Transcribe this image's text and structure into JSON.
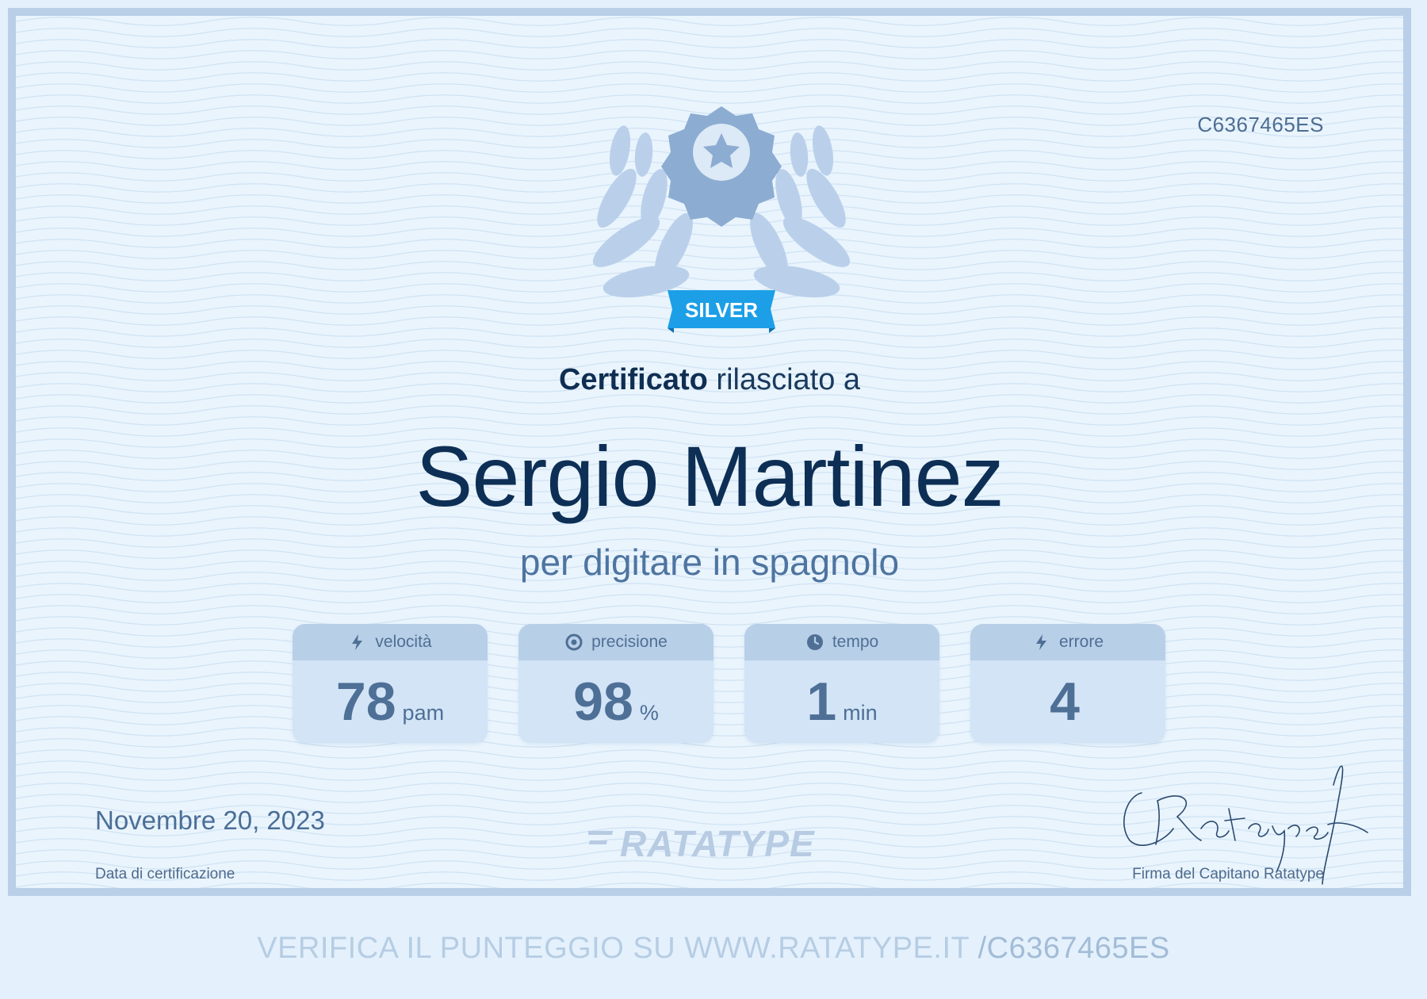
{
  "certificate": {
    "code": "C6367465ES",
    "badge": "SILVER",
    "title_bold": "Certificato",
    "title_rest": "rilasciato a",
    "recipient": "Sergio Martinez",
    "subtitle": "per digitare in spagnolo",
    "stats": [
      {
        "label": "velocità",
        "icon": "lightning-icon",
        "value": "78",
        "unit": "pam"
      },
      {
        "label": "precisione",
        "icon": "target-icon",
        "value": "98",
        "unit": "%"
      },
      {
        "label": "tempo",
        "icon": "clock-icon",
        "value": "1",
        "unit": "min"
      },
      {
        "label": "errore",
        "icon": "lightning-icon",
        "value": "4",
        "unit": ""
      }
    ],
    "date": "Novembre 20, 2023",
    "date_label": "Data di certificazione",
    "logo": "RATATYPE",
    "signature_label": "Firma del Capitano Ratatype"
  },
  "footer": {
    "verify_text": "VERIFICA IL PUNTEGGIO SU WWW.RATATYPE.IT",
    "verify_code": "/C6367465ES"
  },
  "colors": {
    "background": "#e4f1fc",
    "border": "#b9cfe7",
    "name": "#0e2f55",
    "badge": "#1aa0e8",
    "stat_box": "#d2e4f6"
  }
}
